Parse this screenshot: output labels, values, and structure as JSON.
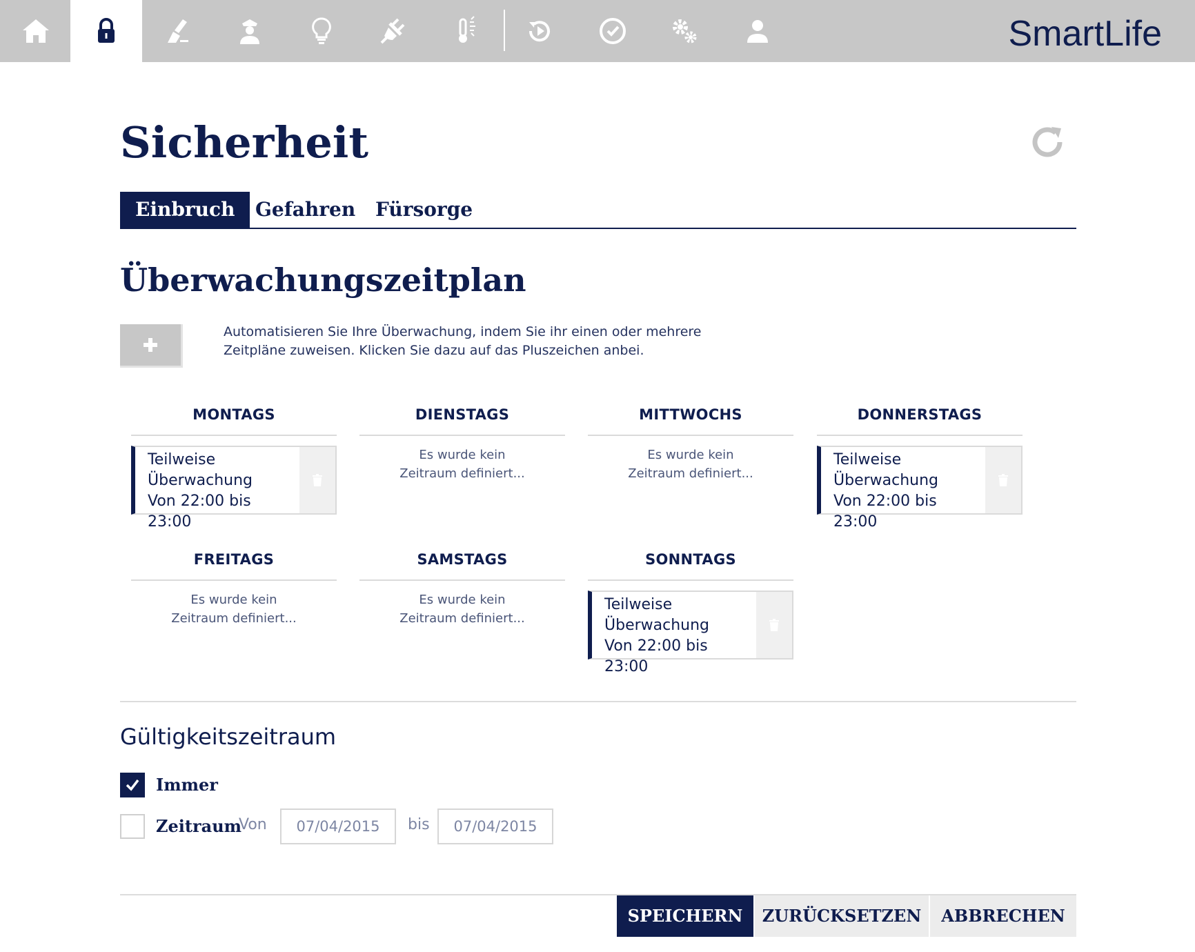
{
  "app": {
    "brand": "SmartLife"
  },
  "nav": {
    "items": [
      {
        "name": "home-icon",
        "active": false
      },
      {
        "name": "lock-icon",
        "active": true
      },
      {
        "name": "broom-icon",
        "active": false
      },
      {
        "name": "guard-icon",
        "active": false
      },
      {
        "name": "lightbulb-icon",
        "active": false
      },
      {
        "name": "plug-icon",
        "active": false
      },
      {
        "name": "thermometer-icon",
        "active": false
      },
      {
        "name": "replay-icon",
        "active": false
      },
      {
        "name": "clock-icon",
        "active": false
      },
      {
        "name": "gears-icon",
        "active": false
      },
      {
        "name": "user-icon",
        "active": false
      }
    ]
  },
  "page": {
    "title": "Sicherheit"
  },
  "tabs": [
    {
      "label": "Einbruch",
      "active": true
    },
    {
      "label": "Gefahren",
      "active": false
    },
    {
      "label": "Fürsorge",
      "active": false
    }
  ],
  "schedule": {
    "title": "Überwachungszeitplan",
    "description": "Automatisieren Sie Ihre Überwachung, indem Sie ihr einen oder mehrere Zeitpläne zuweisen. Klicken Sie dazu auf das Pluszeichen anbei.",
    "days": [
      {
        "label": "MONTAGS",
        "has_entry": true,
        "entry_line1": "Teilweise",
        "entry_line2": "Überwachung",
        "entry_time": "Von 22:00 bis 23:00"
      },
      {
        "label": "DIENSTAGS",
        "has_entry": false,
        "empty_line1": "Es wurde kein",
        "empty_line2": "Zeitraum definiert..."
      },
      {
        "label": "MITTWOCHS",
        "has_entry": false,
        "empty_line1": "Es wurde kein",
        "empty_line2": "Zeitraum definiert..."
      },
      {
        "label": "DONNERSTAGS",
        "has_entry": true,
        "entry_line1": "Teilweise",
        "entry_line2": "Überwachung",
        "entry_time": "Von 22:00 bis 23:00"
      },
      {
        "label": "FREITAGS",
        "has_entry": false,
        "empty_line1": "Es wurde kein",
        "empty_line2": "Zeitraum definiert..."
      },
      {
        "label": "SAMSTAGS",
        "has_entry": false,
        "empty_line1": "Es wurde kein",
        "empty_line2": "Zeitraum definiert..."
      },
      {
        "label": "SONNTAGS",
        "has_entry": true,
        "entry_line1": "Teilweise",
        "entry_line2": "Überwachung",
        "entry_time": "Von 22:00 bis 23:00"
      }
    ]
  },
  "validity": {
    "title": "Gültigkeitszeitraum",
    "always_label": "Immer",
    "always_checked": true,
    "range_label": "Zeitraum",
    "range_checked": false,
    "from_label": "Von",
    "from_value": "07/04/2015",
    "to_label": "bis",
    "to_value": "07/04/2015"
  },
  "actions": {
    "save": "SPEICHERN",
    "reset": "ZURÜCKSETZEN",
    "cancel": "ABBRECHEN"
  },
  "colors": {
    "navy": "#0f1d4e",
    "nav_bg": "#c7c7c7",
    "divider": "#dadada"
  }
}
